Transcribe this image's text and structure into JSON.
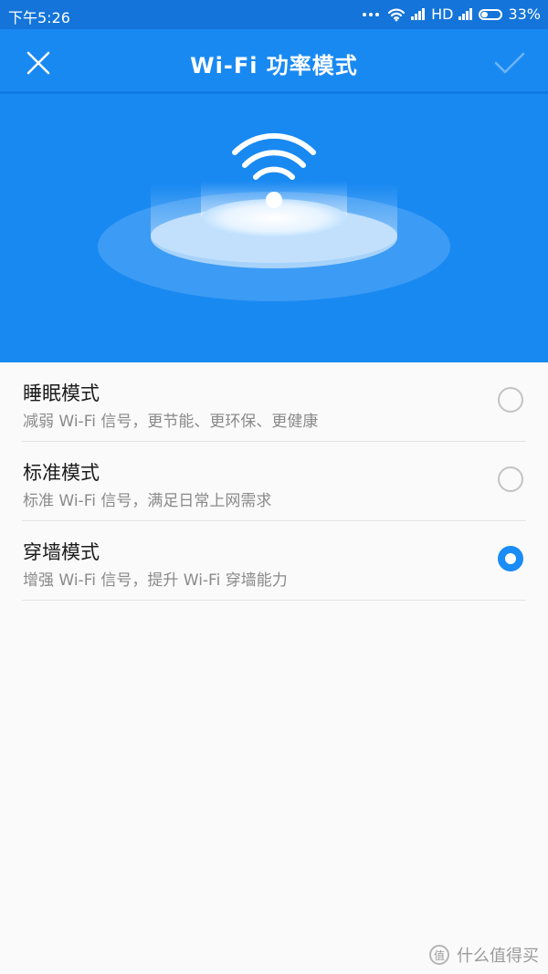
{
  "status_bar": {
    "time": "下午5:26",
    "network": "HD",
    "battery": "33%"
  },
  "header": {
    "title": "Wi-Fi 功率模式",
    "close_icon": "close-icon",
    "confirm_icon": "checkmark-icon"
  },
  "options": [
    {
      "title": "睡眠模式",
      "desc": "减弱 Wi-Fi 信号，更节能、更环保、更健康",
      "selected": false
    },
    {
      "title": "标准模式",
      "desc": "标准 Wi-Fi 信号，满足日常上网需求",
      "selected": false
    },
    {
      "title": "穿墙模式",
      "desc": "增强 Wi-Fi 信号，提升 Wi-Fi 穿墙能力",
      "selected": true
    }
  ],
  "watermark": {
    "icon": "值",
    "text": "什么值得买"
  },
  "colors": {
    "primary": "#1989f2",
    "radio_selected": "#1a8cf5"
  }
}
